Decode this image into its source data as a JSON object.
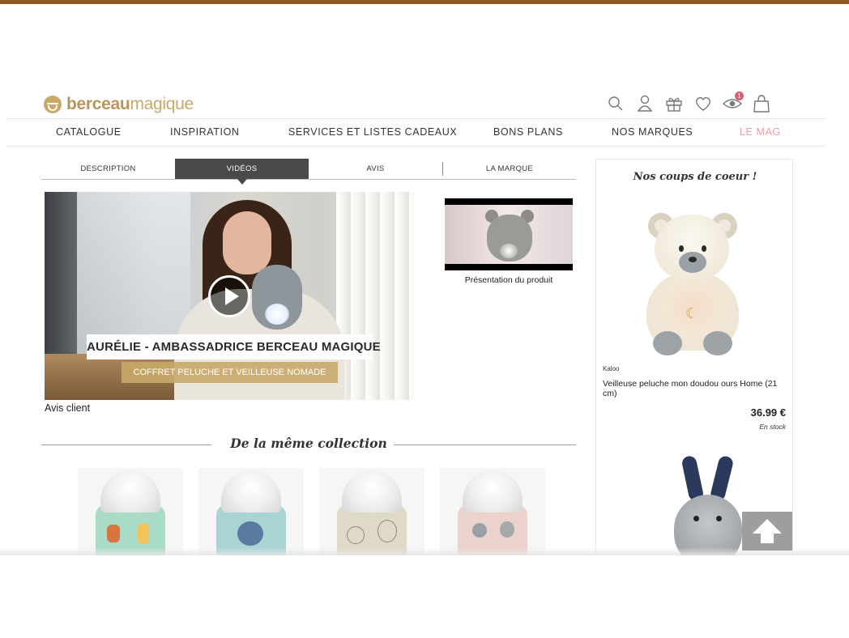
{
  "brand": {
    "logo_bold": "berceau",
    "logo_light": "magique",
    "accent": "#c9a86a",
    "topbar_color": "#8a5a1f"
  },
  "header_icons": [
    {
      "name": "search-icon"
    },
    {
      "name": "user-icon"
    },
    {
      "name": "gift-icon"
    },
    {
      "name": "heart-icon"
    },
    {
      "name": "eye-icon",
      "badge": "1"
    },
    {
      "name": "bag-icon"
    }
  ],
  "nav": {
    "items": [
      "CATALOGUE",
      "INSPIRATION",
      "SERVICES ET LISTES CADEAUX",
      "BONS PLANS",
      "NOS MARQUES",
      "LE MAG"
    ]
  },
  "tabs": {
    "items": [
      "DESCRIPTION",
      "VIDÉOS",
      "AVIS",
      "LA MARQUE"
    ],
    "active": "VIDÉOS"
  },
  "video_main": {
    "title_overlay": "AURÉLIE - AMBASSADRICE BERCEAU MAGIQUE",
    "subtitle_overlay": "COFFRET PELUCHE ET VEILLEUSE NOMADE",
    "caption": "Avis client"
  },
  "video_thumb": {
    "caption": "Présentation du produit"
  },
  "collection": {
    "heading": "De la même collection",
    "products": [
      {
        "name": "mint-lamp",
        "color": "#a9dcc7"
      },
      {
        "name": "blue-lamp",
        "color": "#a8d4d3"
      },
      {
        "name": "beige-lamp",
        "color": "#dfd9c7"
      },
      {
        "name": "pink-lamp",
        "color": "#ecd2cd"
      }
    ]
  },
  "sidebar": {
    "title": "Nos coups de coeur !",
    "product": {
      "brand": "Kaloo",
      "name": "Veilleuse peluche mon doudou ours Home (21 cm)",
      "price": "36.99 €",
      "stock": "En stock"
    }
  }
}
